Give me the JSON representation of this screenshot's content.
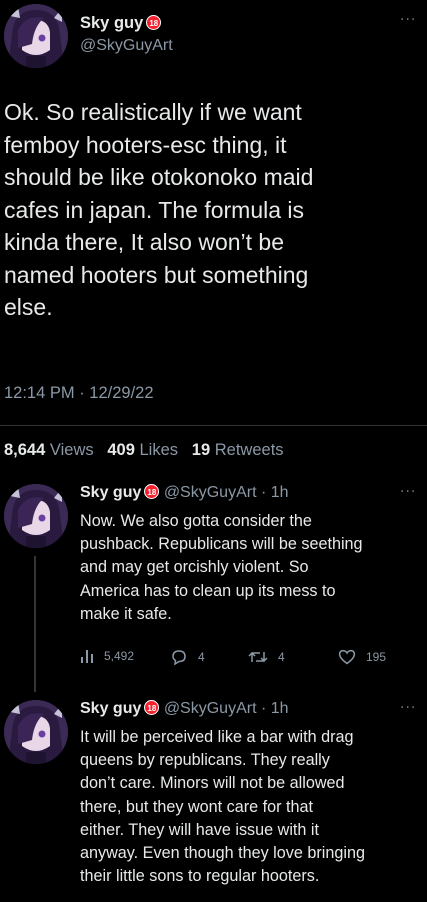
{
  "main_tweet": {
    "author_name": "Sky guy",
    "badge": "18",
    "handle": "@SkyGuyArt",
    "text": "Ok. So realistically if we want\nfemboy hooters-esc thing, it\nshould be like otokonoko maid\ncafes in japan. The formula is\nkinda there, It also won’t be\nnamed hooters but something\nelse.",
    "timestamp": "12:14 PM · 12/29/22",
    "views_count": "8,644",
    "views_label": "Views",
    "likes_count": "409",
    "likes_label": "Likes",
    "retweets_count": "19",
    "retweets_label": "Retweets"
  },
  "replies": [
    {
      "author_name": "Sky guy",
      "badge": "18",
      "meta": "@SkyGuyArt · 1h",
      "text": "Now. We also gotta consider the\npushback. Republicans will be seething\nand may get orcishly violent. So\nAmerica has to clean up its mess to\nmake it safe.",
      "views": "5,492",
      "replies": "4",
      "retweets": "4",
      "likes": "195"
    },
    {
      "author_name": "Sky guy",
      "badge": "18",
      "meta": "@SkyGuyArt · 1h",
      "text": "It will be perceived like a bar with drag\nqueens by republicans. They really\ndon’t care. Minors will not be allowed\nthere, but they wont care for that\neither. They will have issue with it\nanyway. Even though they love bringing\ntheir little sons to regular hooters."
    }
  ],
  "icons": {
    "more": "more-options-icon",
    "views": "views-bar-icon",
    "reply": "reply-bubble-icon",
    "retweet": "retweet-icon",
    "like": "heart-icon"
  },
  "colors": {
    "background": "#000000",
    "text": "#e7e9ea",
    "secondary": "#8b98a5",
    "badge": "#f4212e"
  }
}
